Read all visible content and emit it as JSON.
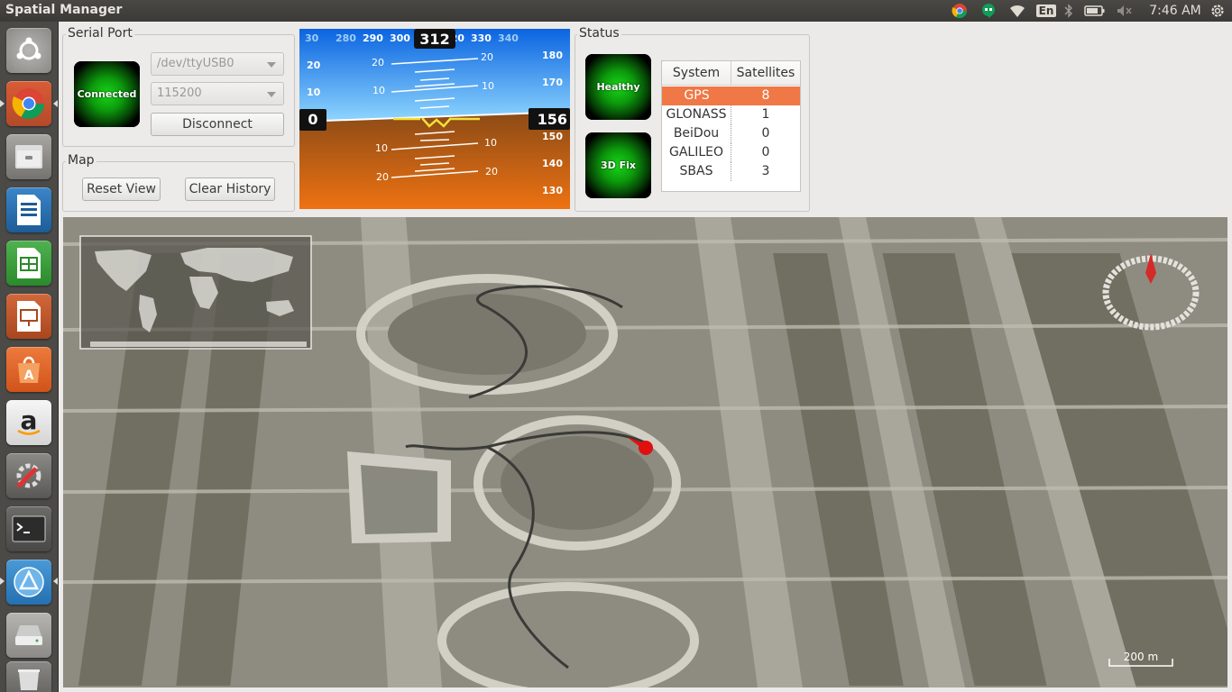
{
  "topbar": {
    "title": "Spatial Manager",
    "keyboard_layout": "En",
    "clock": "7:46 AM"
  },
  "launcher": {
    "items": [
      "dash-icon",
      "chrome-icon",
      "files-icon",
      "writer-icon",
      "calc-icon",
      "impress-icon",
      "software-center-icon",
      "amazon-icon",
      "system-settings-icon",
      "terminal-icon",
      "remmina-icon",
      "disk-icon",
      "trash-icon"
    ]
  },
  "serial_port": {
    "title": "Serial Port",
    "status": "Connected",
    "port": "/dev/ttyUSB0",
    "baud": "115200",
    "disconnect": "Disconnect"
  },
  "map_group": {
    "title": "Map",
    "reset_view": "Reset View",
    "clear_history": "Clear History"
  },
  "attitude": {
    "heading": "312",
    "heading_scale": [
      "30",
      "280",
      "290",
      "300",
      "310",
      "320",
      "330",
      "340"
    ],
    "altitude": "156",
    "altitude_scale": [
      "180",
      "170",
      "160",
      "150",
      "140",
      "130"
    ],
    "speed": "0",
    "speed_scale": [
      "30",
      "20",
      "10"
    ],
    "pitch_labels": [
      "20",
      "10",
      "10",
      "20"
    ]
  },
  "status": {
    "title": "Status",
    "health": "Healthy",
    "fix": "3D Fix",
    "table": {
      "headers": [
        "System",
        "Satellites"
      ],
      "rows": [
        {
          "system": "GPS",
          "count": "8"
        },
        {
          "system": "GLONASS",
          "count": "1"
        },
        {
          "system": "BeiDou",
          "count": "0"
        },
        {
          "system": "GALILEO",
          "count": "0"
        },
        {
          "system": "SBAS",
          "count": "3"
        }
      ]
    }
  },
  "map": {
    "scale_label": "200 m"
  },
  "colors": {
    "selection": "#f07746",
    "led_green": "#18d618",
    "sky": "#2a9fff",
    "ground": "#b05c1e",
    "marker": "#e01010"
  }
}
